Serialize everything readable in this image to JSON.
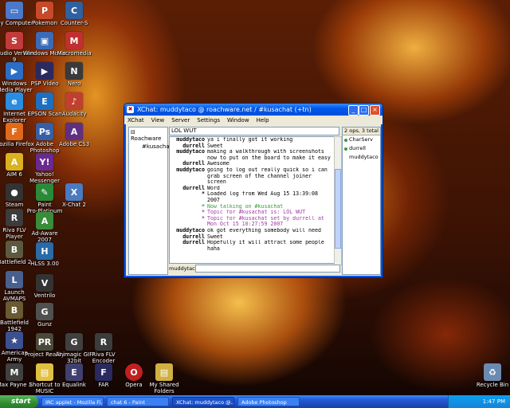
{
  "desktop_icons": [
    {
      "label": "My Computer",
      "icon": "computer-icon",
      "color": "#4a79c9"
    },
    {
      "label": "Studio Version\n9",
      "icon": "studio-icon",
      "color": "#c23b3b"
    },
    {
      "label": "Windows\nMedia Player",
      "icon": "media-player-icon",
      "color": "#2c6ec4"
    },
    {
      "label": "Internet\nExplorer",
      "icon": "ie-icon",
      "color": "#2a8de0"
    },
    {
      "label": "Mozilla Firefox",
      "icon": "firefox-icon",
      "color": "#e06a1a"
    },
    {
      "label": "AIM 6",
      "icon": "aim-icon",
      "color": "#d9b21e"
    },
    {
      "label": "Steam",
      "icon": "steam-icon",
      "color": "#333333"
    },
    {
      "label": "Riva FLV\nPlayer",
      "icon": "riva-icon",
      "color": "#3c3c3c"
    },
    {
      "label": "Battlefield 2",
      "icon": "battlefield-icon",
      "color": "#5a5a40"
    },
    {
      "label": "Launch\nAVMAPS",
      "icon": "launch-icon",
      "color": "#486090"
    },
    {
      "label": "Battlefield\n1942",
      "icon": "battlefield-icon",
      "color": "#6a5a30"
    },
    {
      "label": "Americas\nArmy",
      "icon": "army-icon",
      "color": "#3c5090"
    },
    {
      "label": "Max Payne 2",
      "icon": "game-icon",
      "color": "#404040"
    }
  ],
  "desktop_icons_col2": [
    {
      "label": "Pokemon",
      "icon": "game-icon",
      "color": "#c64a2a"
    },
    {
      "label": "Windows Movie",
      "icon": "movie-icon",
      "color": "#3a6ab8"
    },
    {
      "label": "PSP Video",
      "icon": "video-icon",
      "color": "#2a2a60"
    },
    {
      "label": "EPSON Scan",
      "icon": "scanner-icon",
      "color": "#1d6fc0"
    },
    {
      "label": "Adobe\nPhotoshop",
      "icon": "photoshop-icon",
      "color": "#3560a8"
    },
    {
      "label": "Yahoo!\nMessenger",
      "icon": "yahoo-icon",
      "color": "#6a2a90"
    },
    {
      "label": "Paint\nPro-Platinum",
      "icon": "paint-icon",
      "color": "#2a8a3a"
    },
    {
      "label": "Ad-Aware\n2007",
      "icon": "adaware-icon",
      "color": "#3a8c3a"
    },
    {
      "label": "HLSS 3.00",
      "icon": "app-icon",
      "color": "#2a6aa8"
    },
    {
      "label": "Ventrilo",
      "icon": "ventrilo-icon",
      "color": "#333333"
    },
    {
      "label": "Gunz",
      "icon": "game-icon",
      "color": "#505050"
    },
    {
      "label": "Project Reality",
      "icon": "game-icon",
      "color": "#4a4a3a"
    },
    {
      "label": "Shortcut to\nMUSIC",
      "icon": "folder-icon",
      "color": "#e0c040"
    }
  ],
  "desktop_icons_col3": [
    {
      "label": "Counter-S",
      "icon": "game-icon",
      "color": "#3060a0"
    },
    {
      "label": "Macromedia",
      "icon": "app-icon",
      "color": "#c03030"
    },
    {
      "label": "Nero",
      "icon": "nero-icon",
      "color": "#3a3a3a"
    },
    {
      "label": "Audacity",
      "icon": "app-icon",
      "color": "#c04030"
    },
    {
      "label": "Adobe CS3",
      "icon": "app-icon",
      "color": "#603080"
    },
    {
      "label": "X-Chat 2",
      "icon": "xchat-icon",
      "color": "#4a7ac0"
    },
    {
      "label": "Animagic GIF\n32bit",
      "icon": "gif-icon",
      "color": "#404040"
    },
    {
      "label": "Equalink",
      "icon": "app-icon",
      "color": "#404070"
    }
  ],
  "desktop_icons_col4": [
    {
      "label": "Riva FLV\nEncoder",
      "icon": "riva-icon",
      "color": "#3c3c3c"
    },
    {
      "label": "FAR",
      "icon": "app-icon",
      "color": "#2a2a60"
    }
  ],
  "desktop_icons_col5": [
    {
      "label": "Opera",
      "icon": "opera-icon",
      "color": "#c02020"
    }
  ],
  "desktop_icons_col6": [
    {
      "label": "My Shared\nFolders",
      "icon": "shared-folders-icon",
      "color": "#d0b040"
    }
  ],
  "recycle_bin": {
    "label": "Recycle Bin",
    "icon": "recycle-bin-icon",
    "color": "#6a8ab0"
  },
  "window": {
    "title": "XChat: muddytaco @ roachware.net / #kusachat (+tn)",
    "menu": [
      "XChat",
      "View",
      "Server",
      "Settings",
      "Window",
      "Help"
    ],
    "tree": {
      "server": "Roachware",
      "channel": "#kusachat"
    },
    "topic": "LOL WUT",
    "user_count": "2 ops, 3 total",
    "users": [
      {
        "nick": "CharServ",
        "color": "#3c9a3c"
      },
      {
        "nick": "durrell",
        "color": "#3c9a3c"
      },
      {
        "nick": "muddytaco",
        "color": "#ffffff"
      }
    ],
    "messages": [
      {
        "nick": "muddytaco",
        "text": "ya i finally got it working",
        "color": "#000000"
      },
      {
        "nick": "durrell",
        "text": "Sweet",
        "color": "#000000"
      },
      {
        "nick": "muddytaco",
        "text": "making a walkthrough with screenshots\nnow to put on the board to make it easy",
        "color": "#000000"
      },
      {
        "nick": "durrell",
        "text": "Awesome",
        "color": "#000000"
      },
      {
        "nick": "muddytaco",
        "text": "going to log out really quick so i can\ngrab screen of the channel joiner\nscreen",
        "color": "#000000"
      },
      {
        "nick": "durrell",
        "text": "Word",
        "color": "#000000"
      },
      {
        "nick": "*",
        "text": "Loaded log from Wed Aug 15 13:39:08\n2007",
        "color": "#000000"
      },
      {
        "nick": "*",
        "text": "Now talking on #kusachat",
        "color": "#3c9a3c"
      },
      {
        "nick": "*",
        "text": "Topic for #kusachat is: LOL WUT",
        "color": "#a03ca0"
      },
      {
        "nick": "*",
        "text": "Topic for #kusachat set by durrell at\nMon Oct 15 10:27:59 2007",
        "color": "#a03ca0"
      },
      {
        "nick": "muddytaco",
        "text": "ok got everything somebody will need",
        "color": "#000000"
      },
      {
        "nick": "durrell",
        "text": "Sweet",
        "color": "#000000"
      },
      {
        "nick": "durrell",
        "text": "Hopefully it will attract some people\nhaha",
        "color": "#000000"
      }
    ],
    "input_nick": "muddytaco"
  },
  "taskbar": {
    "start": "start",
    "tasks": [
      "IRC applet - Mozilla Fi...",
      "chat 6 - Paint",
      "XChat: muddytaco @...",
      "Adobe Photoshop"
    ],
    "clock": "1:47 PM"
  }
}
